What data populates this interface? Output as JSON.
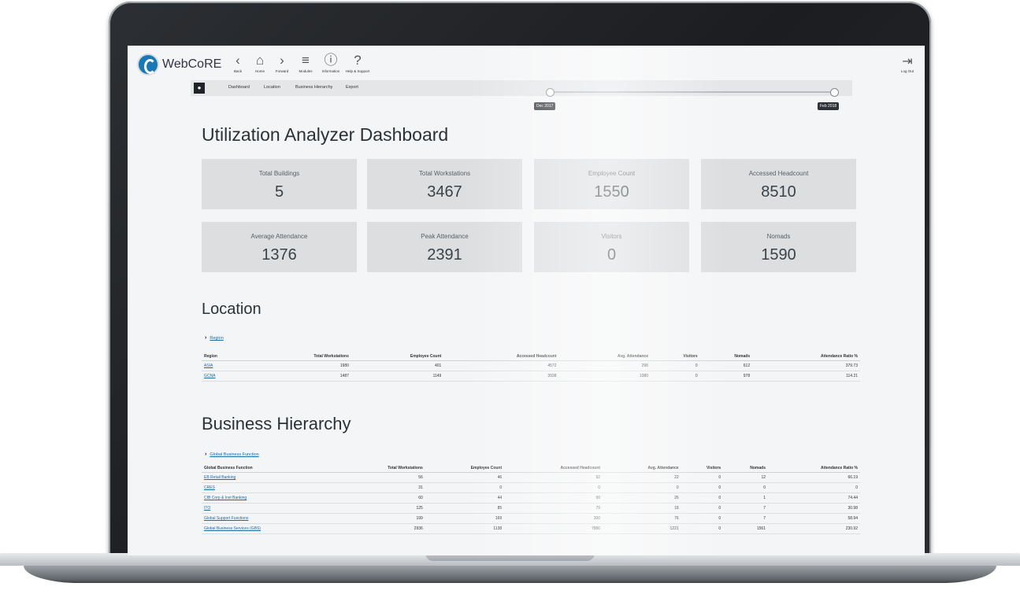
{
  "app": {
    "brand": "WebCoRE"
  },
  "nav": [
    {
      "label": "Back",
      "icon": "back-icon",
      "glyph": "‹"
    },
    {
      "label": "Home",
      "icon": "home-icon",
      "glyph": "⌂"
    },
    {
      "label": "Forward",
      "icon": "forward-icon",
      "glyph": "›"
    },
    {
      "label": "Modules",
      "icon": "menu-icon",
      "glyph": "≡"
    },
    {
      "label": "Information",
      "icon": "info-icon",
      "glyph": "ⓘ"
    },
    {
      "label": "Help & Support",
      "icon": "help-icon",
      "glyph": "?"
    }
  ],
  "logout": {
    "label": "Log Out",
    "glyph": "⇥"
  },
  "subnav": {
    "items": [
      "Dashboard",
      "Location",
      "Business Hierarchy",
      "Export"
    ]
  },
  "date_range": {
    "start": "Dec 2017",
    "end": "Feb 2018"
  },
  "page_title": "Utilization Analyzer Dashboard",
  "stats": [
    {
      "label": "Total Buildings",
      "value": "5"
    },
    {
      "label": "Total Workstations",
      "value": "3467"
    },
    {
      "label": "Employee Count",
      "value": "1550"
    },
    {
      "label": "Accessed Headcount",
      "value": "8510"
    },
    {
      "label": "Average Attendance",
      "value": "1376"
    },
    {
      "label": "Peak Attendance",
      "value": "2391"
    },
    {
      "label": "Visitors",
      "value": "0"
    },
    {
      "label": "Nomads",
      "value": "1590"
    }
  ],
  "location": {
    "title": "Location",
    "expander": "Region",
    "headers": [
      "Region",
      "Total Workstations",
      "Employee Count",
      "Accessed Headcount",
      "Avg. Attendance",
      "Visitors",
      "Nomads",
      "Attendance Ratio %"
    ],
    "rows": [
      [
        "ASIA",
        "1980",
        "401",
        "4572",
        "296",
        "0",
        "612",
        "379.73"
      ],
      [
        "GCNA",
        "1487",
        "1149",
        "3938",
        "1080",
        "0",
        "978",
        "114.21"
      ]
    ]
  },
  "business": {
    "title": "Business Hierarchy",
    "expander": "Global Business Function",
    "headers": [
      "Global Business Function",
      "Total Workstations",
      "Employee Count",
      "Accessed Headcount",
      "Avg. Attendance",
      "Visitors",
      "Nomads",
      "Attendance Ratio %"
    ],
    "rows": [
      [
        "EB Retail Banking",
        "56",
        "46",
        "92",
        "22",
        "0",
        "12",
        "66.19"
      ],
      [
        "CRES",
        "31",
        "0",
        "0",
        "0",
        "0",
        "0",
        "0"
      ],
      [
        "CIB Corp & Inst Banking",
        "60",
        "44",
        "99",
        "26",
        "0",
        "1",
        "74.44"
      ],
      [
        "ITO",
        "125",
        "85",
        "79",
        "18",
        "0",
        "7",
        "30.98"
      ],
      [
        "Global Support Functions",
        "199",
        "169",
        "300",
        "76",
        "0",
        "7",
        "58.94"
      ],
      [
        "Global Business Services (GBS)",
        "2936",
        "1138",
        "7886",
        "1221",
        "0",
        "1561",
        "230.92"
      ]
    ]
  }
}
